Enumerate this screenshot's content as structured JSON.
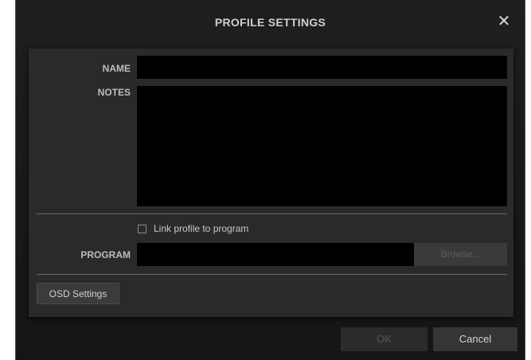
{
  "dialog": {
    "title": "PROFILE SETTINGS",
    "close_glyph": "✕"
  },
  "form": {
    "name_label": "NAME",
    "name_value": "",
    "notes_label": "NOTES",
    "notes_value": "",
    "link_checkbox_label": "Link profile to program",
    "link_checked": false,
    "program_label": "PROGRAM",
    "program_value": "",
    "browse_label": "Browse..."
  },
  "buttons": {
    "osd_settings": "OSD Settings",
    "ok": "OK",
    "cancel": "Cancel"
  },
  "icons": {
    "close": "close-icon",
    "checkbox": "checkbox-icon"
  },
  "colors": {
    "background": "#1a1a1a",
    "panel": "#2a2a2a",
    "field": "#000000",
    "label_text": "#bdbdbd",
    "disabled_text": "#5e5e5e"
  }
}
